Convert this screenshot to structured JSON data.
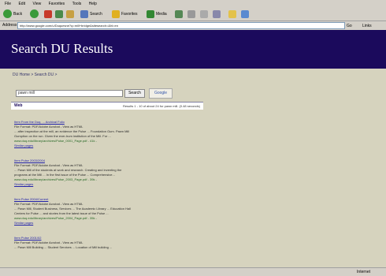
{
  "menubar": {
    "items": [
      "File",
      "Edit",
      "View",
      "Favorites",
      "Tools",
      "Help"
    ]
  },
  "toolbar": {
    "back_label": "Back",
    "search_label": "Search",
    "favorites_label": "Favorites",
    "media_label": "Media"
  },
  "addressbar": {
    "label": "Address",
    "url": "http://www.google.com/u/Duquesne?q=mill+bridge&sitesearch=&hl=en",
    "go_label": "Go",
    "links_label": "Links"
  },
  "header": {
    "title": "Search DU Results"
  },
  "breadcrumb": "DU Home > Search DU >",
  "search": {
    "value": "pawn mill",
    "button_label": "Search",
    "logo_text": "Google"
  },
  "webbar": {
    "label": "Web",
    "info": "Results 1 - 10 of about 24 for pawn mill. (0.48 seconds)"
  },
  "results": [
    {
      "title": "Item From the Duq. ... Archival Folio",
      "meta": "File Format: PDF/Adobe Acrobat - View as HTML",
      "lines": [
        "... after inspection at the mill, an evidence the Pulse ... Foundation Gum. Pawn Mill",
        "Gumption on the run. Given the ever-hum institution of the Mill. For ...",
        "www.duq.edu/library/archives/Pulse_0001_Page.pdf - 41k -"
      ],
      "links": "Similar pages"
    },
    {
      "title": "Item Pulse 2003/2004",
      "meta": "File Format: PDF/Adobe Acrobat - View as HTML",
      "lines": [
        "... Pawn Mill of the students at work and research. Creating and inventing the",
        "programs at the Mill ... In the first issue of the Pulse ... Comprehensive...",
        "www.duq.edu/library/archives/Pulse_2003_Page.pdf - 39k -"
      ],
      "links": "Similar pages"
    },
    {
      "title": "Item Pulse 2004/Current",
      "meta": "File Format: PDF/Adobe Acrobat - View as HTML",
      "lines": [
        "... Pawn Mill, Student Business, Services ... The Academic Library ... Education Hall",
        "Centers for Pulse ... and stories from the latest issue of the Pulse ...",
        "www.duq.edu/library/archives/Pulse_2004_Page.pdf - 35k -"
      ],
      "links": "Similar pages"
    },
    {
      "title": "Item Pulse 2001/02",
      "meta": "File Format: PDF/Adobe Acrobat - View as HTML",
      "lines": [
        "... Pawn Mill Building ... Student Services ... Location of Mill building ..."
      ],
      "links": ""
    }
  ],
  "status": {
    "zone": "Internet"
  }
}
